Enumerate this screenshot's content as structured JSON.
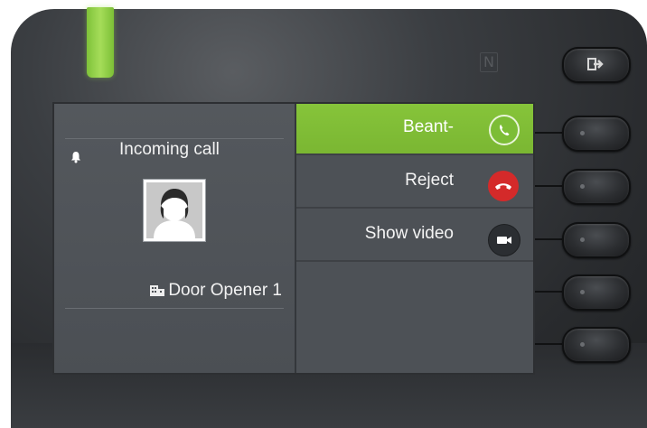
{
  "device": {
    "led_color": "#8fcf45",
    "nfc_mark": "N",
    "exit_key_icon": "exit-arrow-icon"
  },
  "call": {
    "status": "Incoming call",
    "caller_name": "Door Opener 1",
    "bell_icon": "bell-icon",
    "caller_icon": "building-icon",
    "avatar_icon": "person-avatar-icon"
  },
  "menu": {
    "items": [
      {
        "label": "Beant-",
        "icon": "phone-accept-icon",
        "color": "#7cbd36",
        "selected": true
      },
      {
        "label": "Reject",
        "icon": "phone-hangup-icon",
        "color": "#d42a2a",
        "selected": false
      },
      {
        "label": "Show video",
        "icon": "video-camera-icon",
        "color": "#2b2e32",
        "selected": false
      }
    ]
  },
  "colors": {
    "accent_green": "#82c038",
    "reject_red": "#d42a2a",
    "screen_bg": "#4d5156"
  }
}
